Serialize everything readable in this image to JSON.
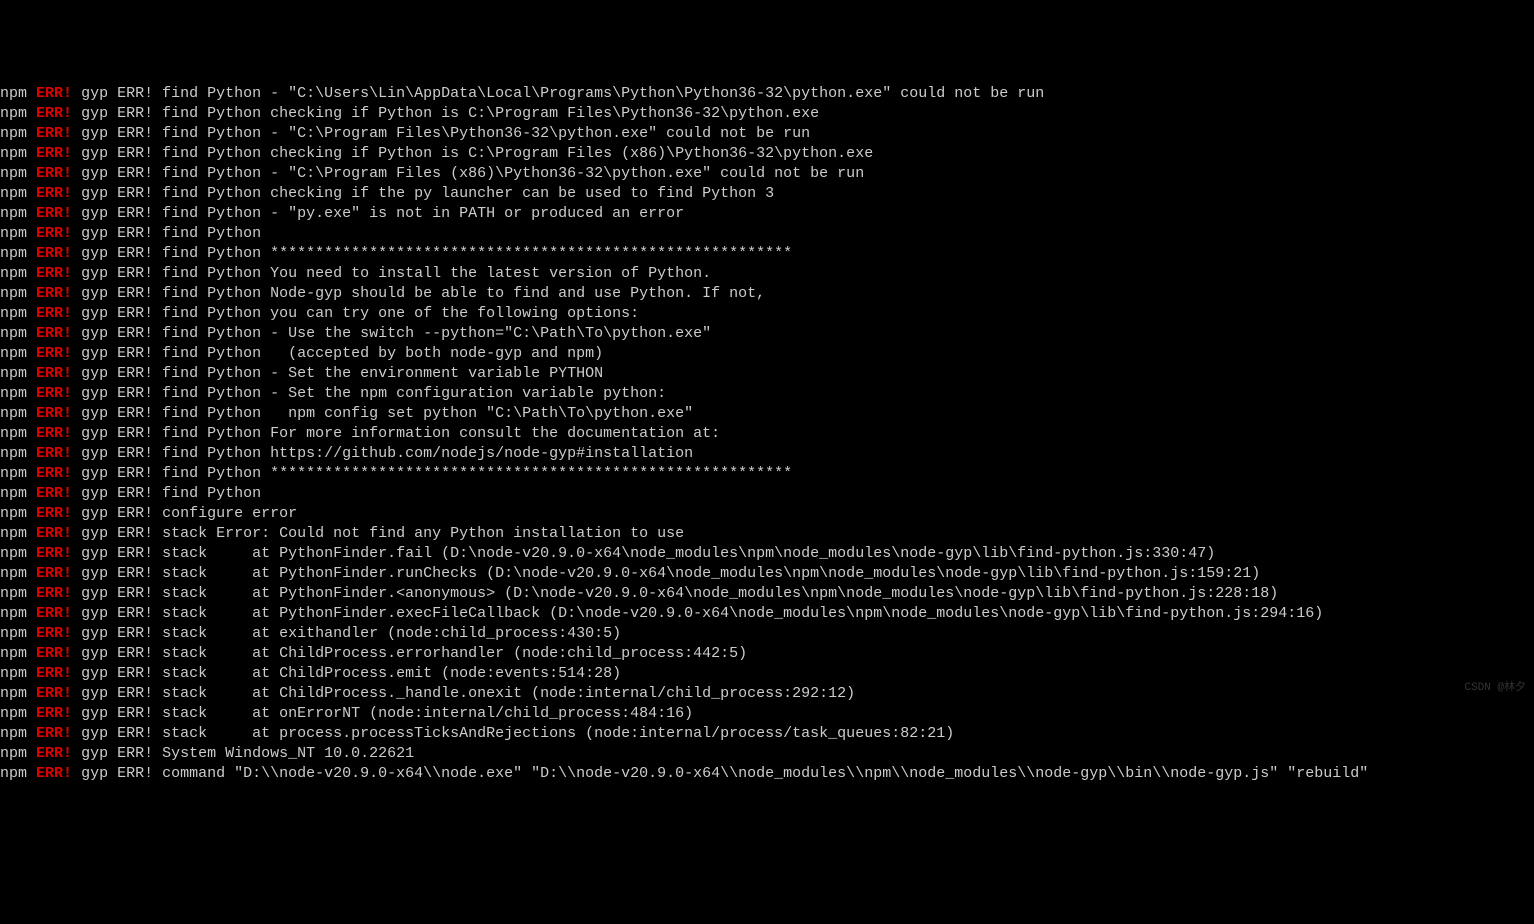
{
  "terminal": {
    "prefix_npm": "npm",
    "prefix_err": "ERR!",
    "lines": [
      {
        "text": "gyp ERR! find Python - \"C:\\Users\\Lin\\AppData\\Local\\Programs\\Python\\Python36-32\\python.exe\" could not be run"
      },
      {
        "text": "gyp ERR! find Python checking if Python is C:\\Program Files\\Python36-32\\python.exe"
      },
      {
        "text": "gyp ERR! find Python - \"C:\\Program Files\\Python36-32\\python.exe\" could not be run"
      },
      {
        "text": "gyp ERR! find Python checking if Python is C:\\Program Files (x86)\\Python36-32\\python.exe"
      },
      {
        "text": "gyp ERR! find Python - \"C:\\Program Files (x86)\\Python36-32\\python.exe\" could not be run"
      },
      {
        "text": "gyp ERR! find Python checking if the py launcher can be used to find Python 3"
      },
      {
        "text": "gyp ERR! find Python - \"py.exe\" is not in PATH or produced an error"
      },
      {
        "text": "gyp ERR! find Python"
      },
      {
        "text": "gyp ERR! find Python **********************************************************"
      },
      {
        "text": "gyp ERR! find Python You need to install the latest version of Python."
      },
      {
        "text": "gyp ERR! find Python Node-gyp should be able to find and use Python. If not,"
      },
      {
        "text": "gyp ERR! find Python you can try one of the following options:"
      },
      {
        "text": "gyp ERR! find Python - Use the switch --python=\"C:\\Path\\To\\python.exe\""
      },
      {
        "text": "gyp ERR! find Python   (accepted by both node-gyp and npm)"
      },
      {
        "text": "gyp ERR! find Python - Set the environment variable PYTHON"
      },
      {
        "text": "gyp ERR! find Python - Set the npm configuration variable python:"
      },
      {
        "text": "gyp ERR! find Python   npm config set python \"C:\\Path\\To\\python.exe\""
      },
      {
        "text": "gyp ERR! find Python For more information consult the documentation at:"
      },
      {
        "text": "gyp ERR! find Python https://github.com/nodejs/node-gyp#installation"
      },
      {
        "text": "gyp ERR! find Python **********************************************************"
      },
      {
        "text": "gyp ERR! find Python"
      },
      {
        "text": "gyp ERR! configure error"
      },
      {
        "text": "gyp ERR! stack Error: Could not find any Python installation to use"
      },
      {
        "text": "gyp ERR! stack     at PythonFinder.fail (D:\\node-v20.9.0-x64\\node_modules\\npm\\node_modules\\node-gyp\\lib\\find-python.js:330:47)"
      },
      {
        "text": "gyp ERR! stack     at PythonFinder.runChecks (D:\\node-v20.9.0-x64\\node_modules\\npm\\node_modules\\node-gyp\\lib\\find-python.js:159:21)"
      },
      {
        "text": "gyp ERR! stack     at PythonFinder.<anonymous> (D:\\node-v20.9.0-x64\\node_modules\\npm\\node_modules\\node-gyp\\lib\\find-python.js:228:18)"
      },
      {
        "text": "gyp ERR! stack     at PythonFinder.execFileCallback (D:\\node-v20.9.0-x64\\node_modules\\npm\\node_modules\\node-gyp\\lib\\find-python.js:294:16)"
      },
      {
        "text": "gyp ERR! stack     at exithandler (node:child_process:430:5)"
      },
      {
        "text": "gyp ERR! stack     at ChildProcess.errorhandler (node:child_process:442:5)"
      },
      {
        "text": "gyp ERR! stack     at ChildProcess.emit (node:events:514:28)"
      },
      {
        "text": "gyp ERR! stack     at ChildProcess._handle.onexit (node:internal/child_process:292:12)"
      },
      {
        "text": "gyp ERR! stack     at onErrorNT (node:internal/child_process:484:16)"
      },
      {
        "text": "gyp ERR! stack     at process.processTicksAndRejections (node:internal/process/task_queues:82:21)"
      },
      {
        "text": "gyp ERR! System Windows_NT 10.0.22621"
      },
      {
        "text": "gyp ERR! command \"D:\\\\node-v20.9.0-x64\\\\node.exe\" \"D:\\\\node-v20.9.0-x64\\\\node_modules\\\\npm\\\\node_modules\\\\node-gyp\\\\bin\\\\node-gyp.js\" \"rebuild\""
      }
    ]
  },
  "watermark": "CSDN @林夕"
}
